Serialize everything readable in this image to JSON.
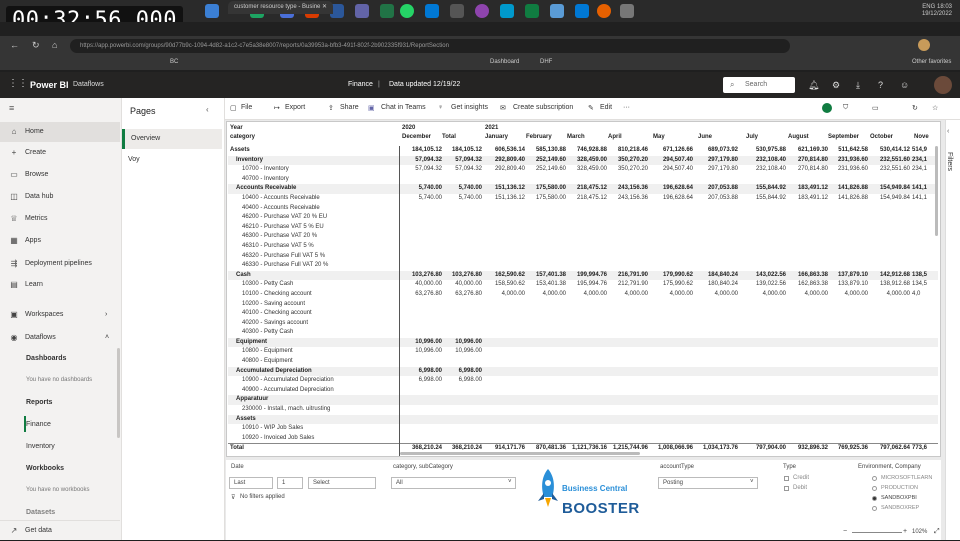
{
  "overlay": {
    "timer": "00:32:56.000"
  },
  "system": {
    "time": "18:03",
    "date": "19/12/2022",
    "lang": "ENG"
  },
  "browser": {
    "tabs": [
      "customer resource type - Busine"
    ],
    "url": "https://app.powerbi.com/groups/90d77b9c-1094-4d82-a1c2-c7e5a38e8007/reports/0a39953a-bfb3-491f-802f-2b902335f931/ReportSection",
    "bookmarks": [
      "BC",
      "Dashboard",
      "DHF",
      "Other favorites"
    ]
  },
  "header": {
    "app": "Power BI",
    "workspace": "Dataflows",
    "report": "Finance",
    "separator": "|",
    "updated": "Data updated 12/19/22",
    "search_placeholder": "Search"
  },
  "nav": {
    "items": [
      {
        "label": "Home",
        "icon": "home-icon"
      },
      {
        "label": "Create",
        "icon": "plus-icon"
      },
      {
        "label": "Browse",
        "icon": "folder-icon"
      },
      {
        "label": "Data hub",
        "icon": "data-hub-icon"
      },
      {
        "label": "Metrics",
        "icon": "trophy-icon"
      },
      {
        "label": "Apps",
        "icon": "apps-icon"
      },
      {
        "label": "Deployment pipelines",
        "icon": "pipeline-icon"
      },
      {
        "label": "Learn",
        "icon": "book-icon"
      },
      {
        "label": "Workspaces",
        "icon": "workspaces-icon"
      },
      {
        "label": "Dataflows",
        "icon": "dataflows-icon"
      }
    ],
    "dashboards": "Dashboards",
    "no_dashboards": "You have no dashboards",
    "reports": "Reports",
    "report_items": [
      "Finance",
      "Inventory"
    ],
    "workbooks": "Workbooks",
    "no_workbooks": "You have no workbooks",
    "datasets": "Datasets",
    "get_data": "Get data"
  },
  "pages": {
    "title": "Pages",
    "items": [
      "Overview",
      "Voy"
    ]
  },
  "toolbar": {
    "file": "File",
    "export": "Export",
    "share": "Share",
    "chat": "Chat in Teams",
    "insights": "Get insights",
    "subscription": "Create subscription",
    "edit": "Edit",
    "more": "···"
  },
  "matrix": {
    "hdr_row_label": "Year",
    "hdr_row_label2": "category",
    "columns": [
      {
        "year": "2020",
        "month": "December"
      },
      {
        "year": "",
        "month": "Total"
      },
      {
        "year": "2021",
        "month": "January"
      },
      {
        "year": "",
        "month": "February"
      },
      {
        "year": "",
        "month": "March"
      },
      {
        "year": "",
        "month": "April"
      },
      {
        "year": "",
        "month": "May"
      },
      {
        "year": "",
        "month": "June"
      },
      {
        "year": "",
        "month": "July"
      },
      {
        "year": "",
        "month": "August"
      },
      {
        "year": "",
        "month": "September"
      },
      {
        "year": "",
        "month": "October"
      },
      {
        "year": "",
        "month": "Nove"
      }
    ],
    "rows": [
      {
        "label": "Assets",
        "lv": 0,
        "v": [
          "184,105.12",
          "184,105.12",
          "606,536.14",
          "585,130.88",
          "746,928.88",
          "810,218.46",
          "671,126.66",
          "689,073.92",
          "530,975.88",
          "621,169.30",
          "511,642.58",
          "530,414.12",
          "514,9"
        ]
      },
      {
        "label": "Inventory",
        "lv": 1,
        "v": [
          "57,094.32",
          "57,094.32",
          "292,809.40",
          "252,149.60",
          "328,459.00",
          "350,270.20",
          "294,507.40",
          "297,179.80",
          "232,108.40",
          "270,814.80",
          "231,936.60",
          "232,551.60",
          "234,1"
        ]
      },
      {
        "label": "10700 - Inventory",
        "lv": 2,
        "v": [
          "57,094.32",
          "57,094.32",
          "292,809.40",
          "252,149.60",
          "328,459.00",
          "350,270.20",
          "294,507.40",
          "297,179.80",
          "232,108.40",
          "270,814.80",
          "231,936.60",
          "232,551.60",
          "234,1"
        ]
      },
      {
        "label": "40700 - Inventory",
        "lv": 2,
        "v": [
          "",
          "",
          "",
          "",
          "",
          "",
          "",
          "",
          "",
          "",
          "",
          "",
          ""
        ]
      },
      {
        "label": "Accounts Receivable",
        "lv": 1,
        "v": [
          "5,740.00",
          "5,740.00",
          "151,136.12",
          "175,580.00",
          "218,475.12",
          "243,156.36",
          "196,628.64",
          "207,053.88",
          "155,844.92",
          "183,491.12",
          "141,826.88",
          "154,949.84",
          "141,1"
        ]
      },
      {
        "label": "10400 - Accounts Receivable",
        "lv": 2,
        "v": [
          "5,740.00",
          "5,740.00",
          "151,136.12",
          "175,580.00",
          "218,475.12",
          "243,156.36",
          "196,628.64",
          "207,053.88",
          "155,844.92",
          "183,491.12",
          "141,826.88",
          "154,949.84",
          "141,1"
        ]
      },
      {
        "label": "40400 - Accounts Receivable",
        "lv": 2,
        "v": [
          "",
          "",
          "",
          "",
          "",
          "",
          "",
          "",
          "",
          "",
          "",
          "",
          ""
        ]
      },
      {
        "label": "46200 - Purchase VAT 20 % EU",
        "lv": 2,
        "v": [
          "",
          "",
          "",
          "",
          "",
          "",
          "",
          "",
          "",
          "",
          "",
          "",
          ""
        ]
      },
      {
        "label": "46210 - Purchase VAT 5 % EU",
        "lv": 2,
        "v": [
          "",
          "",
          "",
          "",
          "",
          "",
          "",
          "",
          "",
          "",
          "",
          "",
          ""
        ]
      },
      {
        "label": "46300 - Purchase VAT 20 %",
        "lv": 2,
        "v": [
          "",
          "",
          "",
          "",
          "",
          "",
          "",
          "",
          "",
          "",
          "",
          "",
          ""
        ]
      },
      {
        "label": "46310 - Purchase VAT 5 %",
        "lv": 2,
        "v": [
          "",
          "",
          "",
          "",
          "",
          "",
          "",
          "",
          "",
          "",
          "",
          "",
          ""
        ]
      },
      {
        "label": "46320 - Purchase Full VAT 5 %",
        "lv": 2,
        "v": [
          "",
          "",
          "",
          "",
          "",
          "",
          "",
          "",
          "",
          "",
          "",
          "",
          ""
        ]
      },
      {
        "label": "46330 - Purchase Full VAT 20 %",
        "lv": 2,
        "v": [
          "",
          "",
          "",
          "",
          "",
          "",
          "",
          "",
          "",
          "",
          "",
          "",
          ""
        ]
      },
      {
        "label": "Cash",
        "lv": 1,
        "v": [
          "103,276.80",
          "103,276.80",
          "162,590.62",
          "157,401.38",
          "199,994.76",
          "216,791.90",
          "179,990.62",
          "184,840.24",
          "143,022.56",
          "166,863.38",
          "137,879.10",
          "142,912.68",
          "138,5"
        ]
      },
      {
        "label": "10300 - Petty Cash",
        "lv": 2,
        "v": [
          "40,000.00",
          "40,000.00",
          "158,590.62",
          "153,401.38",
          "195,994.76",
          "212,791.90",
          "175,990.62",
          "180,840.24",
          "139,022.56",
          "162,863.38",
          "133,879.10",
          "138,912.68",
          "134,5"
        ]
      },
      {
        "label": "10100 - Checking account",
        "lv": 2,
        "v": [
          "63,276.80",
          "63,276.80",
          "4,000.00",
          "4,000.00",
          "4,000.00",
          "4,000.00",
          "4,000.00",
          "4,000.00",
          "4,000.00",
          "4,000.00",
          "4,000.00",
          "4,000.00",
          "4,0"
        ]
      },
      {
        "label": "10200 - Saving account",
        "lv": 2,
        "v": [
          "",
          "",
          "",
          "",
          "",
          "",
          "",
          "",
          "",
          "",
          "",
          "",
          ""
        ]
      },
      {
        "label": "40100 - Checking account",
        "lv": 2,
        "v": [
          "",
          "",
          "",
          "",
          "",
          "",
          "",
          "",
          "",
          "",
          "",
          "",
          ""
        ]
      },
      {
        "label": "40200 - Savings account",
        "lv": 2,
        "v": [
          "",
          "",
          "",
          "",
          "",
          "",
          "",
          "",
          "",
          "",
          "",
          "",
          ""
        ]
      },
      {
        "label": "40300 - Petty Cash",
        "lv": 2,
        "v": [
          "",
          "",
          "",
          "",
          "",
          "",
          "",
          "",
          "",
          "",
          "",
          "",
          ""
        ]
      },
      {
        "label": "Equipment",
        "lv": 1,
        "v": [
          "10,996.00",
          "10,996.00",
          "",
          "",
          "",
          "",
          "",
          "",
          "",
          "",
          "",
          "",
          ""
        ]
      },
      {
        "label": "10800 - Equipment",
        "lv": 2,
        "v": [
          "10,996.00",
          "10,996.00",
          "",
          "",
          "",
          "",
          "",
          "",
          "",
          "",
          "",
          "",
          ""
        ]
      },
      {
        "label": "40800 - Equipment",
        "lv": 2,
        "v": [
          "",
          "",
          "",
          "",
          "",
          "",
          "",
          "",
          "",
          "",
          "",
          "",
          ""
        ]
      },
      {
        "label": "Accumulated Depreciation",
        "lv": 1,
        "v": [
          "6,998.00",
          "6,998.00",
          "",
          "",
          "",
          "",
          "",
          "",
          "",
          "",
          "",
          "",
          ""
        ]
      },
      {
        "label": "10900 - Accumulated Depreciation",
        "lv": 2,
        "v": [
          "6,998.00",
          "6,998.00",
          "",
          "",
          "",
          "",
          "",
          "",
          "",
          "",
          "",
          "",
          ""
        ]
      },
      {
        "label": "40900 - Accumulated Depreciation",
        "lv": 2,
        "v": [
          "",
          "",
          "",
          "",
          "",
          "",
          "",
          "",
          "",
          "",
          "",
          "",
          ""
        ]
      },
      {
        "label": "Apparatuur",
        "lv": 1,
        "v": [
          "",
          "",
          "",
          "",
          "",
          "",
          "",
          "",
          "",
          "",
          "",
          "",
          ""
        ]
      },
      {
        "label": "230000 - Install., mach. uitrusting",
        "lv": 2,
        "v": [
          "",
          "",
          "",
          "",
          "",
          "",
          "",
          "",
          "",
          "",
          "",
          "",
          ""
        ]
      },
      {
        "label": "Assets",
        "lv": 1,
        "v": [
          "",
          "",
          "",
          "",
          "",
          "",
          "",
          "",
          "",
          "",
          "",
          "",
          ""
        ]
      },
      {
        "label": "10910 - WIP Job Sales",
        "lv": 2,
        "v": [
          "",
          "",
          "",
          "",
          "",
          "",
          "",
          "",
          "",
          "",
          "",
          "",
          ""
        ]
      },
      {
        "label": "10920 - Invoiced Job Sales",
        "lv": 2,
        "v": [
          "",
          "",
          "",
          "",
          "",
          "",
          "",
          "",
          "",
          "",
          "",
          "",
          ""
        ]
      },
      {
        "label": "Total",
        "lv": 9,
        "v": [
          "368,210.24",
          "368,210.24",
          "914,171.76",
          "870,481.36",
          "1,121,736.16",
          "1,215,744.96",
          "1,008,066.96",
          "1,034,173.76",
          "797,904.00",
          "932,896.32",
          "769,925.36",
          "797,062.64",
          "773,6"
        ]
      }
    ]
  },
  "slicers": {
    "date": {
      "label": "Date",
      "unit": "Last",
      "count": "1",
      "period": "Select",
      "nofilter": "No filters applied"
    },
    "category": {
      "label": "category, subCategory",
      "value": "All"
    },
    "account": {
      "label": "accountType",
      "value": "Posting"
    },
    "type": {
      "label": "Type",
      "options": [
        "Credit",
        "Debit"
      ]
    },
    "env": {
      "label": "Environment, Company",
      "options": [
        "MICROSOFTLEARN",
        "PRODUCTION",
        "SANDBOXPBI",
        "SANDBOXREP"
      ]
    }
  },
  "logo": {
    "line1": "Business Central",
    "line2": "BOOSTER"
  },
  "filters_label": "Filters",
  "zoom": "102%"
}
